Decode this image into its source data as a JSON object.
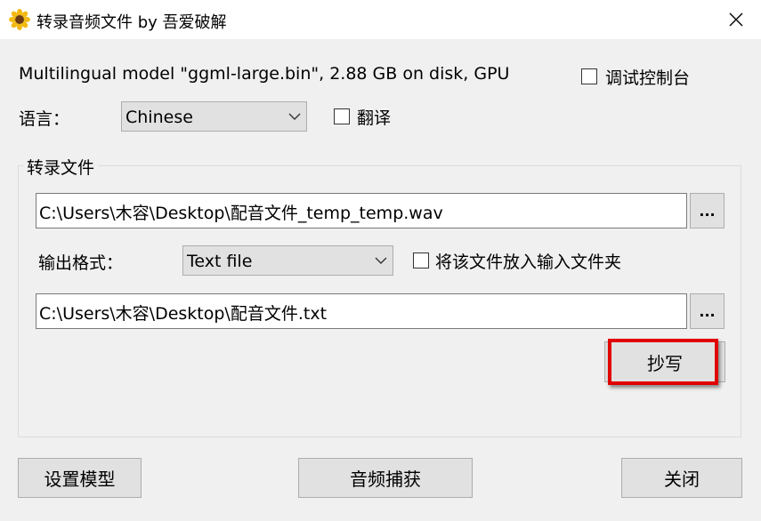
{
  "window": {
    "title": "转录音频文件 by 吾爱破解",
    "icon": "sunflower-icon",
    "close_icon": "close-icon"
  },
  "model_info": "Multilingual model \"ggml-large.bin\", 2.88 GB on disk, GPU",
  "debug_console": {
    "label": "调试控制台",
    "checked": false
  },
  "language": {
    "label": "语言：",
    "selected": "Chinese"
  },
  "translate": {
    "label": "翻译",
    "checked": false
  },
  "transcribe_group": {
    "title": "转录文件",
    "input_path": "C:\\Users\\木容\\Desktop\\配音文件_temp_temp.wav",
    "browse_label": "...",
    "output_format_label": "输出格式：",
    "output_format_selected": "Text file",
    "place_in_input_folder": {
      "label": "将该文件放入输入文件夹",
      "checked": false
    },
    "output_path": "C:\\Users\\木容\\Desktop\\配音文件.txt",
    "browse2_label": "...",
    "transcribe_button": "抄写"
  },
  "footer": {
    "setup_model": "设置模型",
    "audio_capture": "音频捕获",
    "close": "关闭"
  },
  "colors": {
    "highlight": "#e10000",
    "button_face": "#e1e1e1",
    "window_bg": "#f0f0f0"
  }
}
